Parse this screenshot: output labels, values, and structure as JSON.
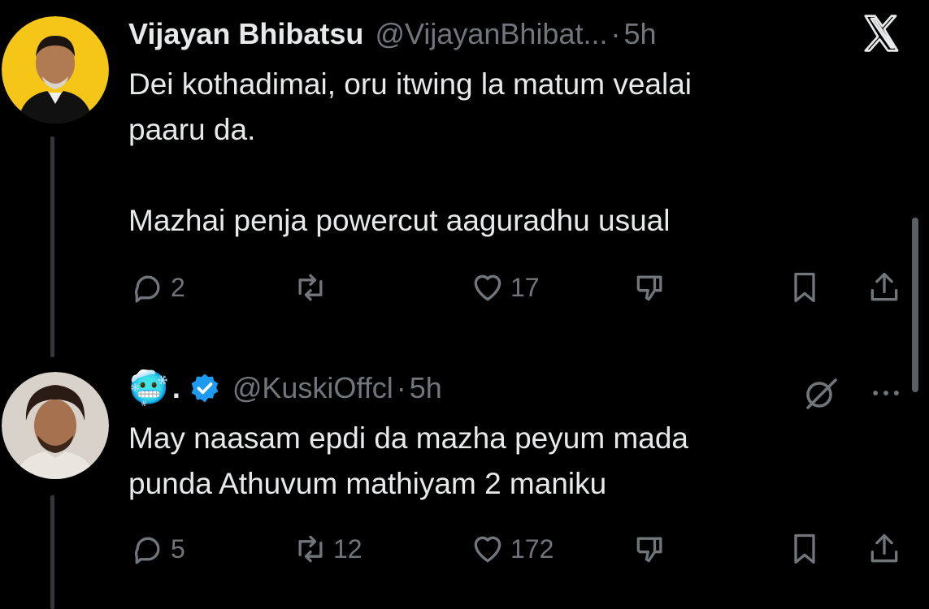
{
  "app": {
    "logo_icon": "x-logo-icon"
  },
  "tweets": [
    {
      "author_name": "Vijayan Bhibatsu",
      "handle": "@VijayanBhibat...",
      "dot": "·",
      "time": "5h",
      "text": "Dei kothadimai, oru itwing la matum vealai\npaaru da.\n\nMazhai penja powercut aaguradhu usual",
      "counts": {
        "replies": "2",
        "retweets": "",
        "likes": "17"
      }
    },
    {
      "author_name_emoji": "🥶",
      "author_name_suffix": ".",
      "verified": true,
      "handle": "@KuskiOffcl",
      "dot": "·",
      "time": "5h",
      "text": "May naasam epdi da mazha peyum mada\npunda Athuvum mathiyam 2 maniku",
      "counts": {
        "replies": "5",
        "retweets": "12",
        "likes": "172"
      }
    }
  ],
  "colors": {
    "background": "#000000",
    "text": "#e7e9ea",
    "muted": "#71767b",
    "verified": "#1d9bf0",
    "avatar1_bg": "#f5c518"
  }
}
